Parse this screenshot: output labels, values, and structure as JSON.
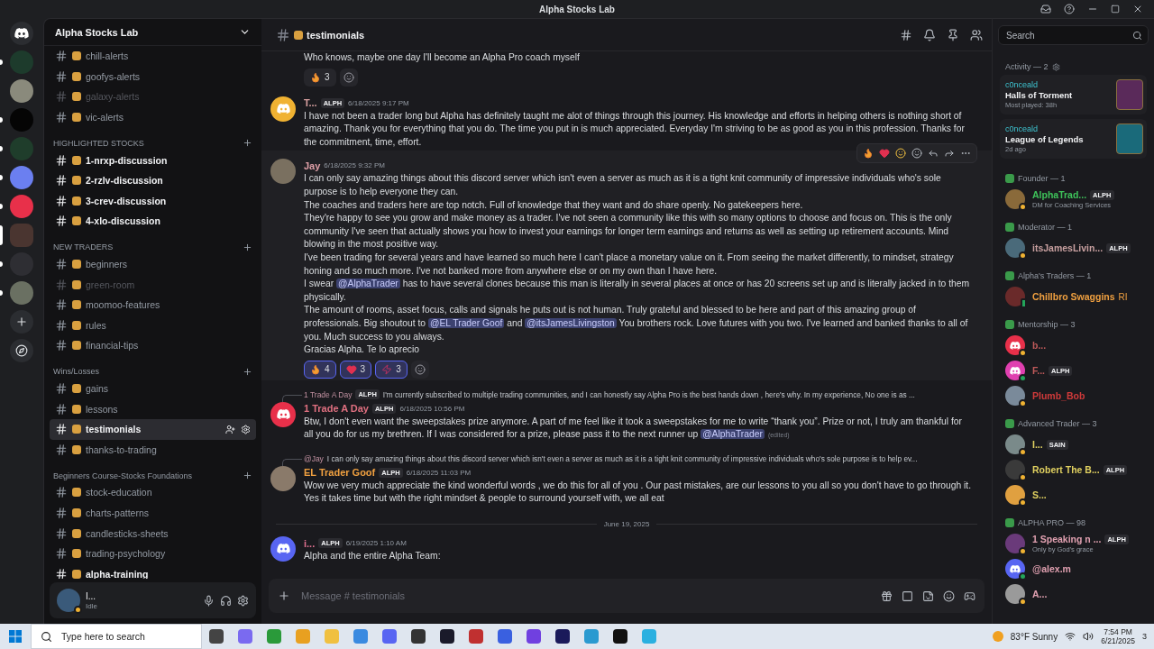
{
  "title_bar": {
    "title": "Alpha Stocks Lab"
  },
  "servers": [
    {
      "kind": "home",
      "color": "#2b2d31",
      "unread": false,
      "selected": false
    },
    {
      "kind": "server",
      "color": "#1d3b2c",
      "unread": true,
      "selected": false
    },
    {
      "kind": "server",
      "color": "#8a8a7c",
      "unread": false,
      "selected": false
    },
    {
      "kind": "server",
      "color": "#050505",
      "unread": true,
      "selected": false
    },
    {
      "kind": "server",
      "color": "#1f3d2b",
      "unread": true,
      "selected": false
    },
    {
      "kind": "server",
      "color": "#6b7ff0",
      "unread": true,
      "selected": false
    },
    {
      "kind": "server",
      "color": "#e8304a",
      "unread": true,
      "selected": false
    },
    {
      "kind": "server",
      "color": "#4a3530",
      "unread": false,
      "selected": true
    },
    {
      "kind": "server",
      "color": "#2e2e33",
      "unread": true,
      "selected": false
    },
    {
      "kind": "server",
      "color": "#6a7062",
      "unread": true,
      "selected": false
    },
    {
      "kind": "add",
      "color": "#2b2d31",
      "unread": false,
      "selected": false
    },
    {
      "kind": "discover",
      "color": "#2b2d31",
      "unread": false,
      "selected": false
    }
  ],
  "sidebar": {
    "server_name": "Alpha Stocks Lab",
    "categories": [
      {
        "channels": [
          {
            "name": "chill-alerts",
            "unread": false,
            "muted": false,
            "selected": false
          },
          {
            "name": "goofys-alerts",
            "unread": false,
            "muted": false,
            "selected": false
          },
          {
            "name": "galaxy-alerts",
            "unread": false,
            "muted": true,
            "selected": false
          },
          {
            "name": "vic-alerts",
            "unread": false,
            "muted": false,
            "selected": false
          }
        ]
      },
      {
        "name": "HIGHLIGHTED STOCKS",
        "channels": [
          {
            "name": "1-nrxp-discussion",
            "unread": true,
            "muted": false,
            "selected": false
          },
          {
            "name": "2-rzlv-discussion",
            "unread": true,
            "muted": false,
            "selected": false
          },
          {
            "name": "3-crev-discussion",
            "unread": true,
            "muted": false,
            "selected": false
          },
          {
            "name": "4-xlo-discussion",
            "unread": true,
            "muted": false,
            "selected": false
          }
        ]
      },
      {
        "name": "NEW TRADERS",
        "channels": [
          {
            "name": "beginners",
            "unread": false,
            "muted": false,
            "selected": false
          },
          {
            "name": "green-room",
            "unread": false,
            "muted": true,
            "selected": false
          },
          {
            "name": "moomoo-features",
            "unread": false,
            "muted": false,
            "selected": false
          },
          {
            "name": "rules",
            "unread": false,
            "muted": false,
            "selected": false
          },
          {
            "name": "financial-tips",
            "unread": false,
            "muted": false,
            "selected": false
          }
        ]
      },
      {
        "name": "Wins/Losses",
        "channels": [
          {
            "name": "gains",
            "unread": false,
            "muted": false,
            "selected": false
          },
          {
            "name": "lessons",
            "unread": false,
            "muted": false,
            "selected": false
          },
          {
            "name": "testimonials",
            "unread": false,
            "muted": false,
            "selected": true
          },
          {
            "name": "thanks-to-trading",
            "unread": false,
            "muted": false,
            "selected": false
          }
        ]
      },
      {
        "name": "Beginners Course-Stocks Foundations",
        "channels": [
          {
            "name": "stock-education",
            "unread": false,
            "muted": false,
            "selected": false
          },
          {
            "name": "charts-patterns",
            "unread": false,
            "muted": false,
            "selected": false
          },
          {
            "name": "candlesticks-sheets",
            "unread": false,
            "muted": false,
            "selected": false
          },
          {
            "name": "trading-psychology",
            "unread": false,
            "muted": false,
            "selected": false
          },
          {
            "name": "alpha-training",
            "unread": true,
            "muted": false,
            "selected": false
          }
        ]
      }
    ],
    "user": {
      "name": "I...",
      "status": "Idle"
    }
  },
  "chat": {
    "channel": "testimonials",
    "placeholder": "Message # testimonials",
    "messages": [
      {
        "kind": "continuation",
        "hovered": false,
        "lines": [
          [
            {
              "kind": "text",
              "text": "Who knows, maybe one day I'll become an Alpha Pro coach myself"
            }
          ]
        ],
        "reactions": [
          {
            "kind": "fire",
            "count": "3",
            "selected": false
          }
        ]
      },
      {
        "kind": "message",
        "hovered": false,
        "author": "T...",
        "color": "#d9a0a0",
        "tag": "ALPH",
        "avatar": {
          "kind": "default",
          "color": "#f0b232"
        },
        "time": "6/18/2025 9:17 PM",
        "lines": [
          [
            {
              "kind": "text",
              "text": "I have not been a trader long but Alpha has definitely taught me alot of things through this journey.  His knowledge and efforts in helping others is nothing short of amazing.  Thank you for everything that you do.  The time you put in is much appreciated.   Everyday I'm striving to be as good as you in this profession.   Thanks for the commitment, time, effort."
            }
          ]
        ]
      },
      {
        "kind": "message",
        "hovered": true,
        "author": "Jay",
        "color": "#e0a0a8",
        "avatar": {
          "kind": "photo",
          "color": "#7a7060"
        },
        "time": "6/18/2025 9:32 PM",
        "lines": [
          [
            {
              "kind": "text",
              "text": "I can only say amazing things about this discord server which isn't even a server as much as it is a tight knit community of impressive individuals who's sole purpose is to help everyone they can."
            }
          ],
          [
            {
              "kind": "text",
              "text": "The coaches and traders here are top notch.  Full of knowledge that they want and do share openly.  No gatekeepers here."
            }
          ],
          [
            {
              "kind": "text",
              "text": "They're happy to see you grow and make money as a trader.  I've not seen a community like this with so many options to choose and focus on.  This is the only community I've seen that actually shows you how to invest your earnings for longer term earnings and returns as well as setting up retirement accounts. Mind blowing in the most positive way."
            }
          ],
          [
            {
              "kind": "text",
              "text": "I've been trading for several years and have learned so much here I can't place a monetary value on it.  From seeing the market differently, to mindset, strategy honing and so much more.  I've not banked more from anywhere else or on my own than I have here."
            }
          ],
          [
            {
              "kind": "text",
              "text": "I swear "
            },
            {
              "kind": "mention",
              "text": "@AlphaTrader"
            },
            {
              "kind": "text",
              "text": " has to have several clones because this man is literally in several places at once or has 20 screens set up and is literally jacked in to them physically."
            }
          ],
          [
            {
              "kind": "text",
              "text": "The amount of rooms, asset focus, calls and signals he puts out is not human.  Truly grateful and blessed to be here and part of this amazing group of professionals.  Big shoutout to "
            },
            {
              "kind": "mention",
              "text": "@EL Trader Goof"
            },
            {
              "kind": "text",
              "text": " and "
            },
            {
              "kind": "mention",
              "text": "@itsJamesLivingston"
            },
            {
              "kind": "text",
              "text": " You brothers rock.  Love futures with you two.  I've learned and banked thanks to all of you.  Much success to you always."
            }
          ],
          [
            {
              "kind": "text",
              "text": "Gracias Alpha. Te lo aprecio"
            }
          ]
        ],
        "reactions": [
          {
            "kind": "fire",
            "count": "4",
            "selected": true
          },
          {
            "kind": "heart",
            "count": "3",
            "selected": true
          },
          {
            "kind": "chart",
            "count": "3",
            "selected": true
          }
        ]
      },
      {
        "kind": "message",
        "hovered": false,
        "author": "1 Trade A Day",
        "color": "#e07080",
        "tag": "ALPH",
        "avatar": {
          "kind": "default",
          "color": "#e8304a"
        },
        "time": "6/18/2025 10:56 PM",
        "reply": {
          "author": "1 Trade A Day",
          "tag": "ALPH",
          "text": "I'm currently subscribed to multiple trading communities, and I can honestly say Alpha Pro is the best hands down , here's why.  In my experience, No one is as ..."
        },
        "lines": [
          [
            {
              "kind": "text",
              "text": "Btw, I don't even want the sweepstakes prize anymore. A part of me feel like it took a sweepstakes for me to write “thank you”. Prize or not, I truly am thankful for all you do for us my brethren. If I was considered for a prize, please pass it to the next runner up "
            },
            {
              "kind": "mention",
              "text": "@AlphaTrader"
            },
            {
              "kind": "edited",
              "text": "(edited)"
            }
          ]
        ]
      },
      {
        "kind": "message",
        "hovered": false,
        "author": "EL Trader Goof",
        "color": "#f0a040",
        "tag": "ALPH",
        "avatar": {
          "kind": "photo",
          "color": "#8a7a6a"
        },
        "time": "6/18/2025 11:03 PM",
        "reply": {
          "author": "@Jay",
          "text": "I can only say amazing things about this discord server which isn't even a server as much as it is a tight knit community of impressive individuals who's sole purpose is to help ev..."
        },
        "lines": [
          [
            {
              "kind": "text",
              "text": "Wow we very much appreciate the kind wonderful words , we do this for all of you . Our past mistakes, are our lessons to you all so you don't have to go through it. Yes it takes time but with the right mindset & people to surround yourself with, we all eat"
            }
          ]
        ]
      },
      {
        "kind": "divider",
        "text": "June 19, 2025"
      },
      {
        "kind": "message",
        "hovered": false,
        "author": "i...",
        "color": "#e07090",
        "tag": "ALPH",
        "avatar": {
          "kind": "default",
          "color": "#5865f2"
        },
        "time": "6/19/2025 1:10 AM",
        "lines": [
          [
            {
              "kind": "text",
              "text": "Alpha and the entire Alpha Team:"
            }
          ]
        ]
      }
    ]
  },
  "members": {
    "search_placeholder": "Search",
    "activity_title": "Activity — 2",
    "activities": [
      {
        "user": "c0nceald",
        "game": "Halls of Torment",
        "detail": "Most played: 38h",
        "art": {
          "color": "#5a2a5a"
        }
      },
      {
        "user": "c0nceald",
        "game": "League of Legends",
        "detail": "2d ago",
        "art": {
          "color": "#1a6a7a"
        }
      }
    ],
    "groups": [
      {
        "title": "Founder — 1",
        "members": [
          {
            "name": "AlphaTrad...",
            "color": "#3ec35a",
            "tag": "ALPH",
            "subtitle": "DM for Coaching Services",
            "status": {
              "kind": "idle"
            },
            "avatar": {
              "kind": "photo",
              "color": "#8a6a3a"
            }
          }
        ]
      },
      {
        "title": "Moderator — 1",
        "members": [
          {
            "name": "itsJamesLivin...",
            "color": "#c8a0a0",
            "tag": "ALPH",
            "status": {
              "kind": "idle"
            },
            "avatar": {
              "kind": "photo",
              "color": "#4a6a7a"
            }
          }
        ]
      },
      {
        "title": "Alpha's Traders — 1",
        "members": [
          {
            "name": "Chillbro Swaggins",
            "color": "#f0a040",
            "extra": "RI",
            "status": {
              "kind": "mobile"
            },
            "avatar": {
              "kind": "photo",
              "color": "#6a2a2a"
            }
          }
        ]
      },
      {
        "title": "Mentorship — 3",
        "members": [
          {
            "name": "b...",
            "color": "#c05a5a",
            "status": {
              "kind": "idle"
            },
            "avatar": {
              "kind": "default",
              "color": "#e8304a"
            }
          },
          {
            "name": "F...",
            "color": "#c05a5a",
            "tag": "ALPH",
            "status": {
              "kind": "online"
            },
            "avatar": {
              "kind": "default",
              "color": "#e040b0"
            }
          },
          {
            "name": "Plumb_Bob",
            "color": "#d03a3a",
            "status": {
              "kind": "idle"
            },
            "avatar": {
              "kind": "photo",
              "color": "#7a8a9a"
            }
          }
        ]
      },
      {
        "title": "Advanced Trader — 3",
        "members": [
          {
            "name": "I...",
            "color": "#e0d060",
            "tag": "SAIN",
            "status": {
              "kind": "idle"
            },
            "avatar": {
              "kind": "photo",
              "color": "#7a8a8a"
            }
          },
          {
            "name": "Robert The B...",
            "color": "#e0d060",
            "tag": "ALPH",
            "status": {
              "kind": "idle"
            },
            "avatar": {
              "kind": "photo",
              "color": "#3a3a3a"
            }
          },
          {
            "name": "S...",
            "color": "#e0d060",
            "status": {
              "kind": "idle"
            },
            "avatar": {
              "kind": "photo",
              "color": "#e0a040"
            }
          }
        ]
      },
      {
        "title": "ALPHA PRO — 98",
        "members": [
          {
            "name": "1 Speaking n ...",
            "color": "#e0a0b0",
            "tag": "ALPH",
            "subtitle": "Only by God's grace",
            "status": {
              "kind": "idle"
            },
            "avatar": {
              "kind": "photo",
              "color": "#6a3a7a"
            }
          },
          {
            "name": "@alex.m",
            "color": "#e0a0b0",
            "status": {
              "kind": "online"
            },
            "avatar": {
              "kind": "default",
              "color": "#5865f2"
            }
          },
          {
            "name": "A...",
            "color": "#e0a0b0",
            "status": {
              "kind": "idle"
            },
            "avatar": {
              "kind": "photo",
              "color": "#9a9a9a"
            }
          }
        ]
      }
    ]
  },
  "taskbar": {
    "search_placeholder": "Type here to search",
    "weather": "83°F  Sunny",
    "time": "7:54 PM",
    "date": "6/21/2025",
    "notifications": "3"
  }
}
